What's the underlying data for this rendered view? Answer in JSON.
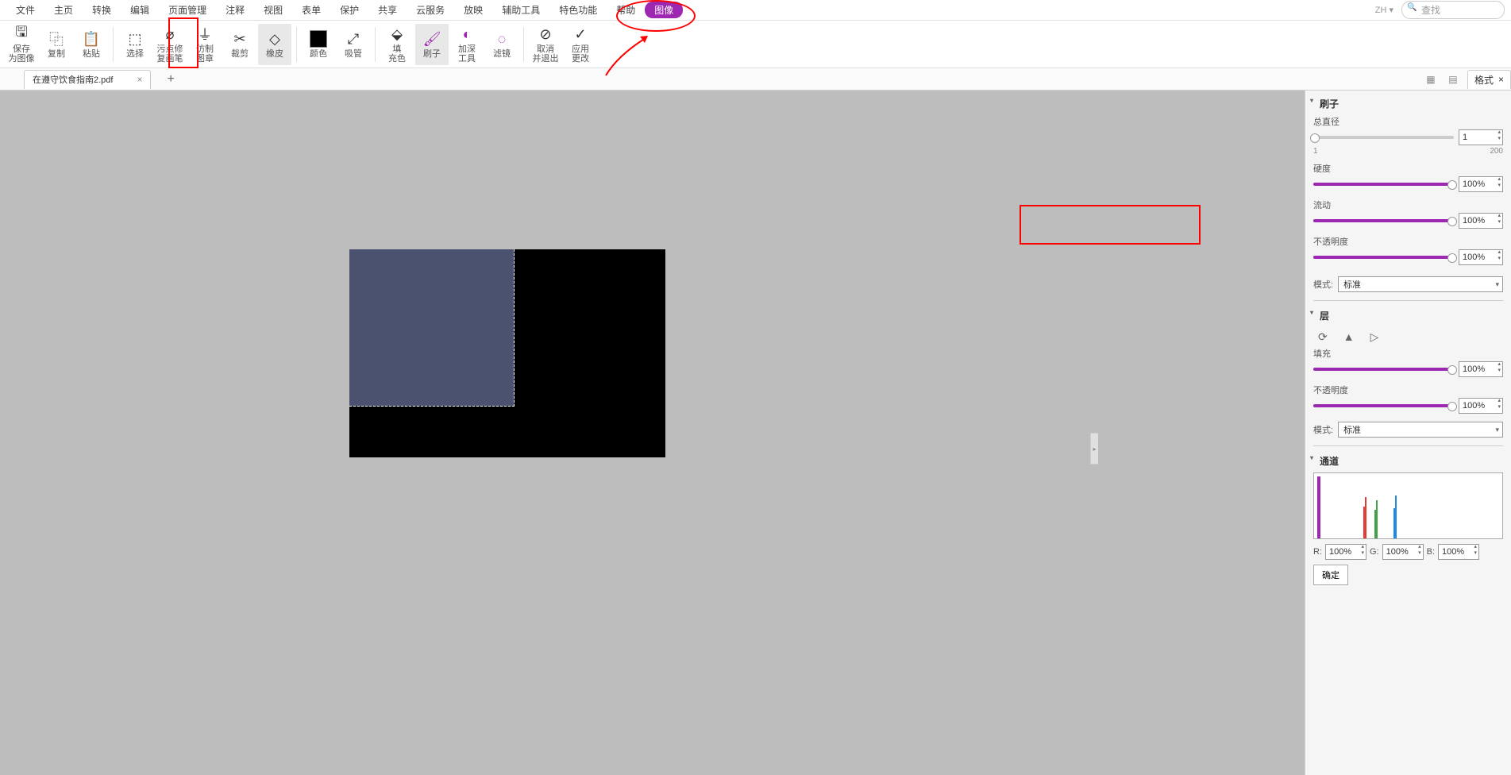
{
  "menu": {
    "items": [
      "文件",
      "主页",
      "转换",
      "编辑",
      "页面管理",
      "注释",
      "视图",
      "表单",
      "保护",
      "共享",
      "云服务",
      "放映",
      "辅助工具",
      "特色功能",
      "帮助",
      "图像"
    ],
    "active_index": 15,
    "search_placeholder": "查找",
    "lang": "ZH ▾"
  },
  "toolbar": {
    "items": [
      {
        "label": "保存\n为图像",
        "icon": "💾"
      },
      {
        "label": "复制",
        "icon": "⿻"
      },
      {
        "label": "粘贴",
        "icon": "📋"
      },
      {
        "sep": true
      },
      {
        "label": "选择",
        "icon": "⬚",
        "drop": true
      },
      {
        "label": "污点修\n复画笔",
        "icon": "🩹"
      },
      {
        "label": "仿制\n图章",
        "icon": "⎃"
      },
      {
        "label": "裁剪",
        "icon": "✂"
      },
      {
        "label": "橡皮",
        "icon": "◇",
        "selected": true
      },
      {
        "sep": true
      },
      {
        "label": "颜色",
        "icon": "swatch"
      },
      {
        "label": "吸管",
        "icon": "💉"
      },
      {
        "sep": true
      },
      {
        "label": "填\n充色",
        "icon": "🪣"
      },
      {
        "label": "刷子",
        "icon": "🖌",
        "selected": true,
        "purple": true
      },
      {
        "label": "加深\n工具",
        "icon": "◐",
        "drop": true
      },
      {
        "label": "滤镜",
        "icon": "◌",
        "drop": true
      },
      {
        "sep": true
      },
      {
        "label": "取消\n并退出",
        "icon": "⊘"
      },
      {
        "label": "应用\n更改",
        "icon": "✓"
      }
    ]
  },
  "tabs": {
    "doc_name": "在遵守饮食指南2.pdf",
    "right_tab": "格式"
  },
  "panel": {
    "brush": {
      "title": "刷子",
      "diameter_label": "总直径",
      "diameter_value": "1",
      "diameter_min": "1",
      "diameter_max": "200",
      "hardness_label": "硬度",
      "hardness_value": "100%",
      "flow_label": "流动",
      "flow_value": "100%",
      "opacity_label": "不透明度",
      "opacity_value": "100%",
      "mode_label": "模式:",
      "mode_value": "标准"
    },
    "layer": {
      "title": "层",
      "fill_label": "填充",
      "fill_value": "100%",
      "opacity_label": "不透明度",
      "opacity_value": "100%",
      "mode_label": "模式:",
      "mode_value": "标准"
    },
    "channel": {
      "title": "通道",
      "r_label": "R:",
      "r_value": "100%",
      "g_label": "G:",
      "g_value": "100%",
      "b_label": "B:",
      "b_value": "100%",
      "ok": "确定"
    }
  }
}
